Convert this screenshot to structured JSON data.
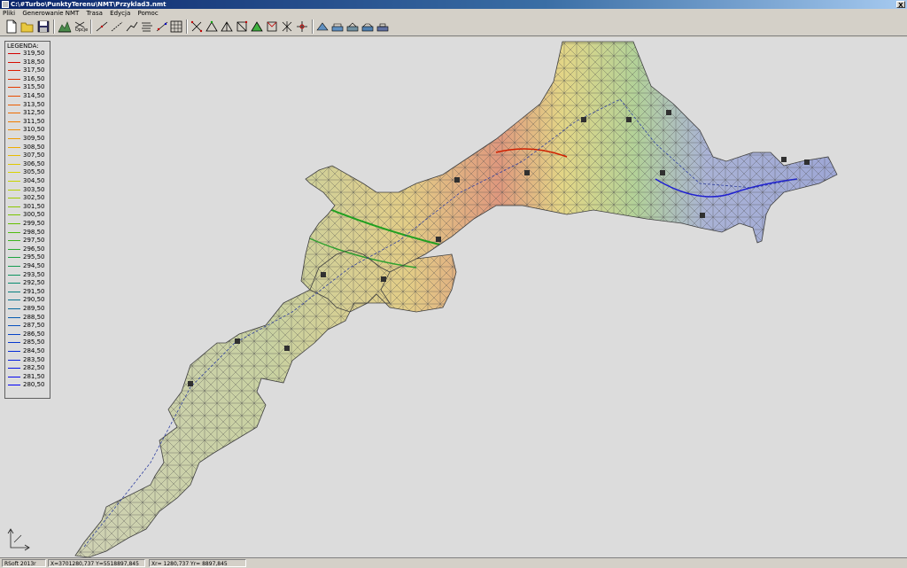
{
  "window": {
    "title": "C:\\#Turbo\\PunktyTerenu\\NMT\\Przyklad3.nmt",
    "close_label": "X"
  },
  "menu": [
    "Pliki",
    "Generowanie NMT",
    "Trasa",
    "Edycja",
    "Pomoc"
  ],
  "toolbar": {
    "options_label": "Opcje",
    "buttons": [
      "new-file-icon",
      "open-folder-icon",
      "save-icon",
      "terrain-view-icon",
      "options-icon",
      "line-1-icon",
      "line-2-icon",
      "line-3-icon",
      "contour-icon",
      "points-icon",
      "grid-icon",
      "tin-1-icon",
      "tin-2-icon",
      "tin-3-icon",
      "tin-4-icon",
      "tin-5-icon",
      "tin-6-icon",
      "tin-7-icon",
      "tin-8-icon",
      "tin-9-icon",
      "profile-1-icon",
      "profile-2-icon",
      "profile-3-icon",
      "profile-4-icon",
      "profile-5-icon"
    ]
  },
  "legend": {
    "title": "LEGENDA:",
    "items": [
      {
        "value": "319,50",
        "color": "#d40000"
      },
      {
        "value": "318,50",
        "color": "#d80c00"
      },
      {
        "value": "317,50",
        "color": "#dc1c00"
      },
      {
        "value": "316,50",
        "color": "#e02c00"
      },
      {
        "value": "315,50",
        "color": "#e43c00"
      },
      {
        "value": "314,50",
        "color": "#e84c00"
      },
      {
        "value": "313,50",
        "color": "#ec5c00"
      },
      {
        "value": "312,50",
        "color": "#f06c00"
      },
      {
        "value": "311,50",
        "color": "#f07c00"
      },
      {
        "value": "310,50",
        "color": "#f08c00"
      },
      {
        "value": "309,50",
        "color": "#f09c00"
      },
      {
        "value": "308,50",
        "color": "#f0ac00"
      },
      {
        "value": "307,50",
        "color": "#e8bc00"
      },
      {
        "value": "306,50",
        "color": "#e0c800"
      },
      {
        "value": "305,50",
        "color": "#d8d400"
      },
      {
        "value": "304,50",
        "color": "#c8d400"
      },
      {
        "value": "303,50",
        "color": "#b4d000"
      },
      {
        "value": "302,50",
        "color": "#a0cc00"
      },
      {
        "value": "301,50",
        "color": "#8cc800"
      },
      {
        "value": "300,50",
        "color": "#78c400"
      },
      {
        "value": "299,50",
        "color": "#64c000"
      },
      {
        "value": "298,50",
        "color": "#50bc10"
      },
      {
        "value": "297,50",
        "color": "#3cb420"
      },
      {
        "value": "296,50",
        "color": "#28ac30"
      },
      {
        "value": "295,50",
        "color": "#1ca440"
      },
      {
        "value": "294,50",
        "color": "#149c50"
      },
      {
        "value": "293,50",
        "color": "#0c9460"
      },
      {
        "value": "292,50",
        "color": "#088c70"
      },
      {
        "value": "291,50",
        "color": "#068080"
      },
      {
        "value": "290,50",
        "color": "#067490"
      },
      {
        "value": "289,50",
        "color": "#0668a0"
      },
      {
        "value": "288,50",
        "color": "#065cb0"
      },
      {
        "value": "287,50",
        "color": "#0650c0"
      },
      {
        "value": "286,50",
        "color": "#0644c8"
      },
      {
        "value": "285,50",
        "color": "#0638d0"
      },
      {
        "value": "284,50",
        "color": "#062cd8"
      },
      {
        "value": "283,50",
        "color": "#0620e0"
      },
      {
        "value": "282,50",
        "color": "#0614e8"
      },
      {
        "value": "281,50",
        "color": "#0608f0"
      },
      {
        "value": "280,50",
        "color": "#0000f8"
      }
    ]
  },
  "status": {
    "version": "RSoft 2013r",
    "coords1": "X=3701280,737 Y=5518897,845",
    "coords2": "Xr= 1280,737 Yr= 8897,845"
  }
}
